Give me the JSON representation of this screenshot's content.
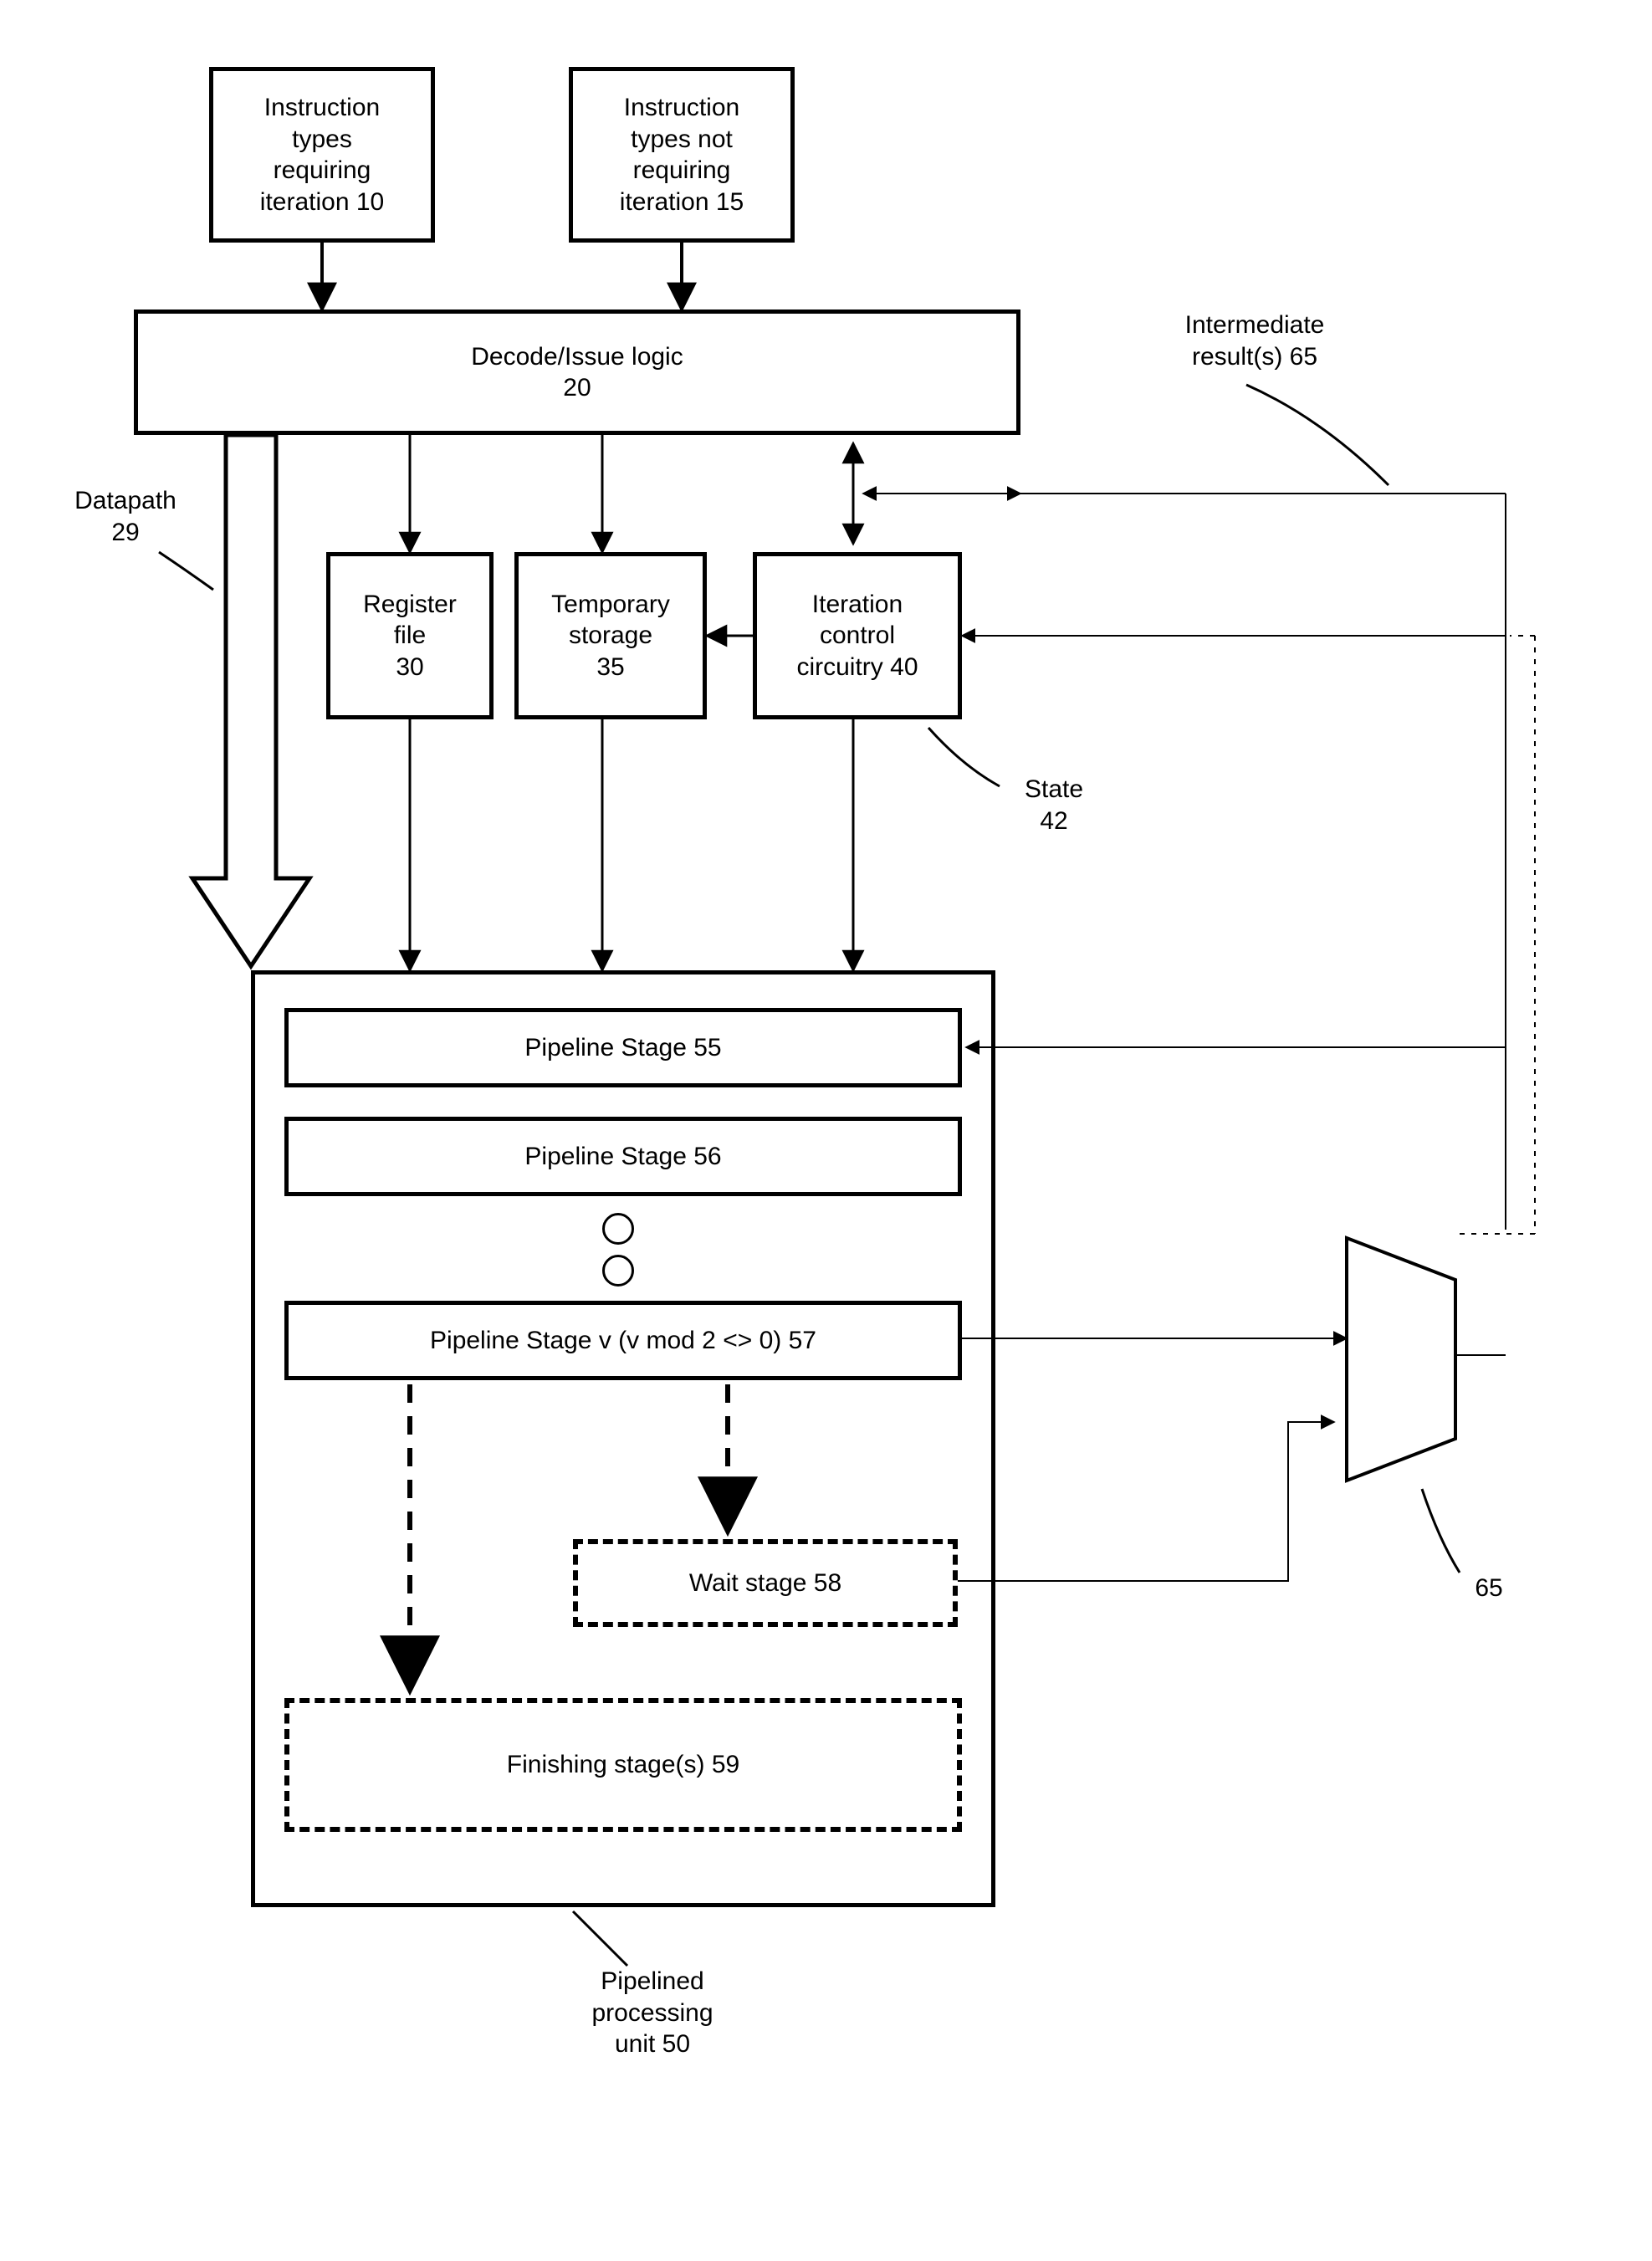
{
  "top": {
    "box10": "Instruction\ntypes\nrequiring\niteration 10",
    "box15": "Instruction\ntypes not\nrequiring\niteration 15"
  },
  "decode": "Decode/Issue logic\n20",
  "datapath_label": "Datapath\n29",
  "intermediate_label": "Intermediate\nresult(s) 65",
  "regfile": "Register\nfile\n30",
  "tempstorage": "Temporary\nstorage\n35",
  "iteration": "Iteration\ncontrol\ncircuitry 40",
  "state_label": "State\n42",
  "pipe55": "Pipeline Stage 55",
  "pipe56": "Pipeline Stage 56",
  "pipe57": "Pipeline Stage v (v mod 2 <> 0) 57",
  "wait58": "Wait stage 58",
  "finish59": "Finishing stage(s) 59",
  "pipelined_label": "Pipelined\nprocessing\nunit 50",
  "mux_label": "65"
}
